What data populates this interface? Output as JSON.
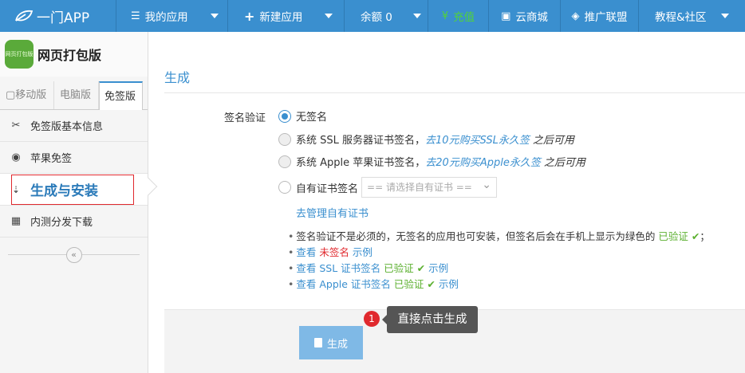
{
  "topnav": {
    "logo": "一门APP",
    "my_apps": "我的应用",
    "new_app": "新建应用",
    "balance": "余额 0",
    "recharge": "充值",
    "cloud_store": "云商城",
    "affiliate": "推广联盟",
    "community": "教程&社区"
  },
  "sidebar": {
    "app_icon_text": "网页打包版",
    "app_name": "网页打包版",
    "tabs": [
      "移动版",
      "电脑版",
      "免签版"
    ],
    "items": [
      {
        "label": "免签版基本信息"
      },
      {
        "label": "苹果免签"
      },
      {
        "label": "生成与安装"
      },
      {
        "label": "内测分发下载"
      }
    ],
    "collapse": "«"
  },
  "main": {
    "section_title": "生成",
    "sign_label": "签名验证",
    "options": [
      {
        "label": "无签名"
      },
      {
        "label": "系统 SSL 服务器证书签名，",
        "link": "去10元购买SSL永久签",
        "after": "之后可用"
      },
      {
        "label": "系统 Apple 苹果证书签名，",
        "link": "去20元购买Apple永久签",
        "after": "之后可用"
      },
      {
        "label": "自有证书签名",
        "select_placeholder": "== 请选择自有证书 =="
      }
    ],
    "manage_link": "去管理自有证书",
    "notes": {
      "n1_a": "签名验证不是必须的，无签名的应用也可安装，但签名后会在手机上显示为绿色的",
      "n1_b": "已验证",
      "n1_c": "；",
      "n2_a": "查看",
      "n2_b": "未签名",
      "n2_c": "示例",
      "n3_a": "查看 SSL 证书签名",
      "n3_b": "已验证",
      "n3_c": "示例",
      "n4_a": "查看 Apple 证书签名",
      "n4_b": "已验证",
      "n4_c": "示例"
    },
    "generate_button": "生成",
    "badge": "1",
    "tooltip": "直接点击生成"
  }
}
